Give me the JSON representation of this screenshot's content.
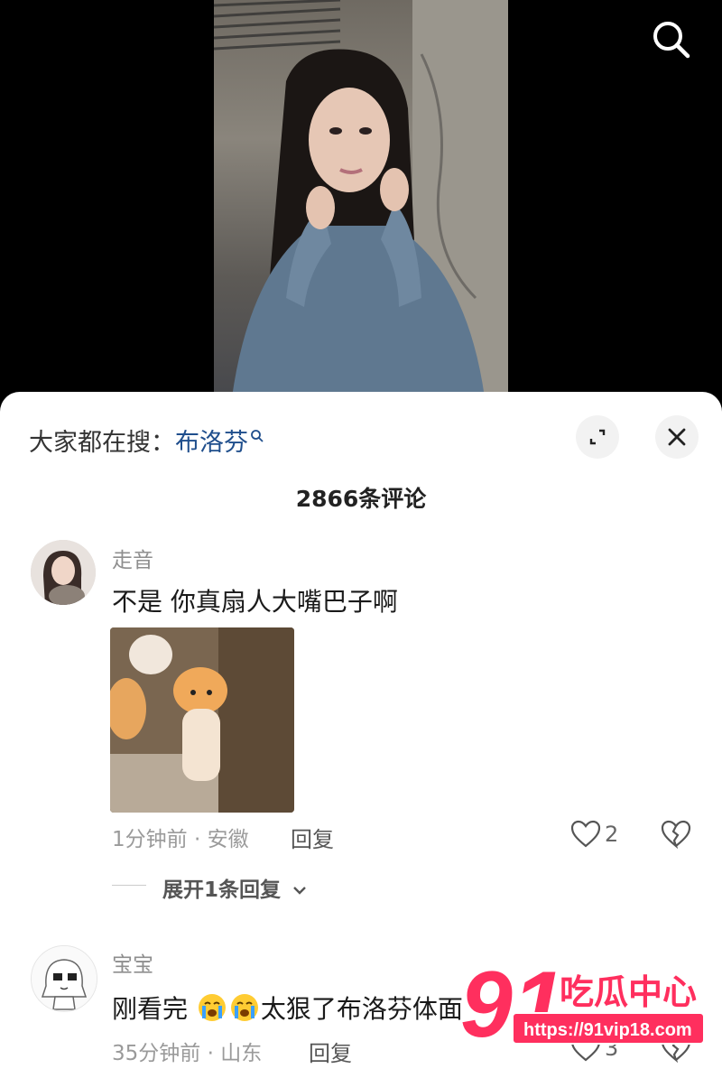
{
  "header": {
    "trending_prefix": "大家都在搜：",
    "trending_keyword": "布洛芬",
    "comment_count": "2866条评论"
  },
  "comments": [
    {
      "username": "走音",
      "text": "不是 你真扇人大嘴巴子啊",
      "meta": "1分钟前 · 安徽",
      "reply_label": "回复",
      "likes": "2",
      "expand_label": "展开1条回复"
    },
    {
      "username": "宝宝",
      "text_before": "刚看完 ",
      "text_after": "太狠了布洛芬体面",
      "meta": "35分钟前 · 山东",
      "reply_label": "回复",
      "likes": "3"
    }
  ],
  "watermark": {
    "number": "91",
    "title": "吃瓜中心",
    "url": "https://91vip18.com"
  },
  "icons": {
    "search": "search-icon",
    "expand": "expand-icon",
    "close": "close-icon",
    "like": "heart-icon",
    "dislike": "broken-heart-icon"
  },
  "colors": {
    "keyword": "#1f4e8c",
    "watermark": "#ff2f5e"
  }
}
